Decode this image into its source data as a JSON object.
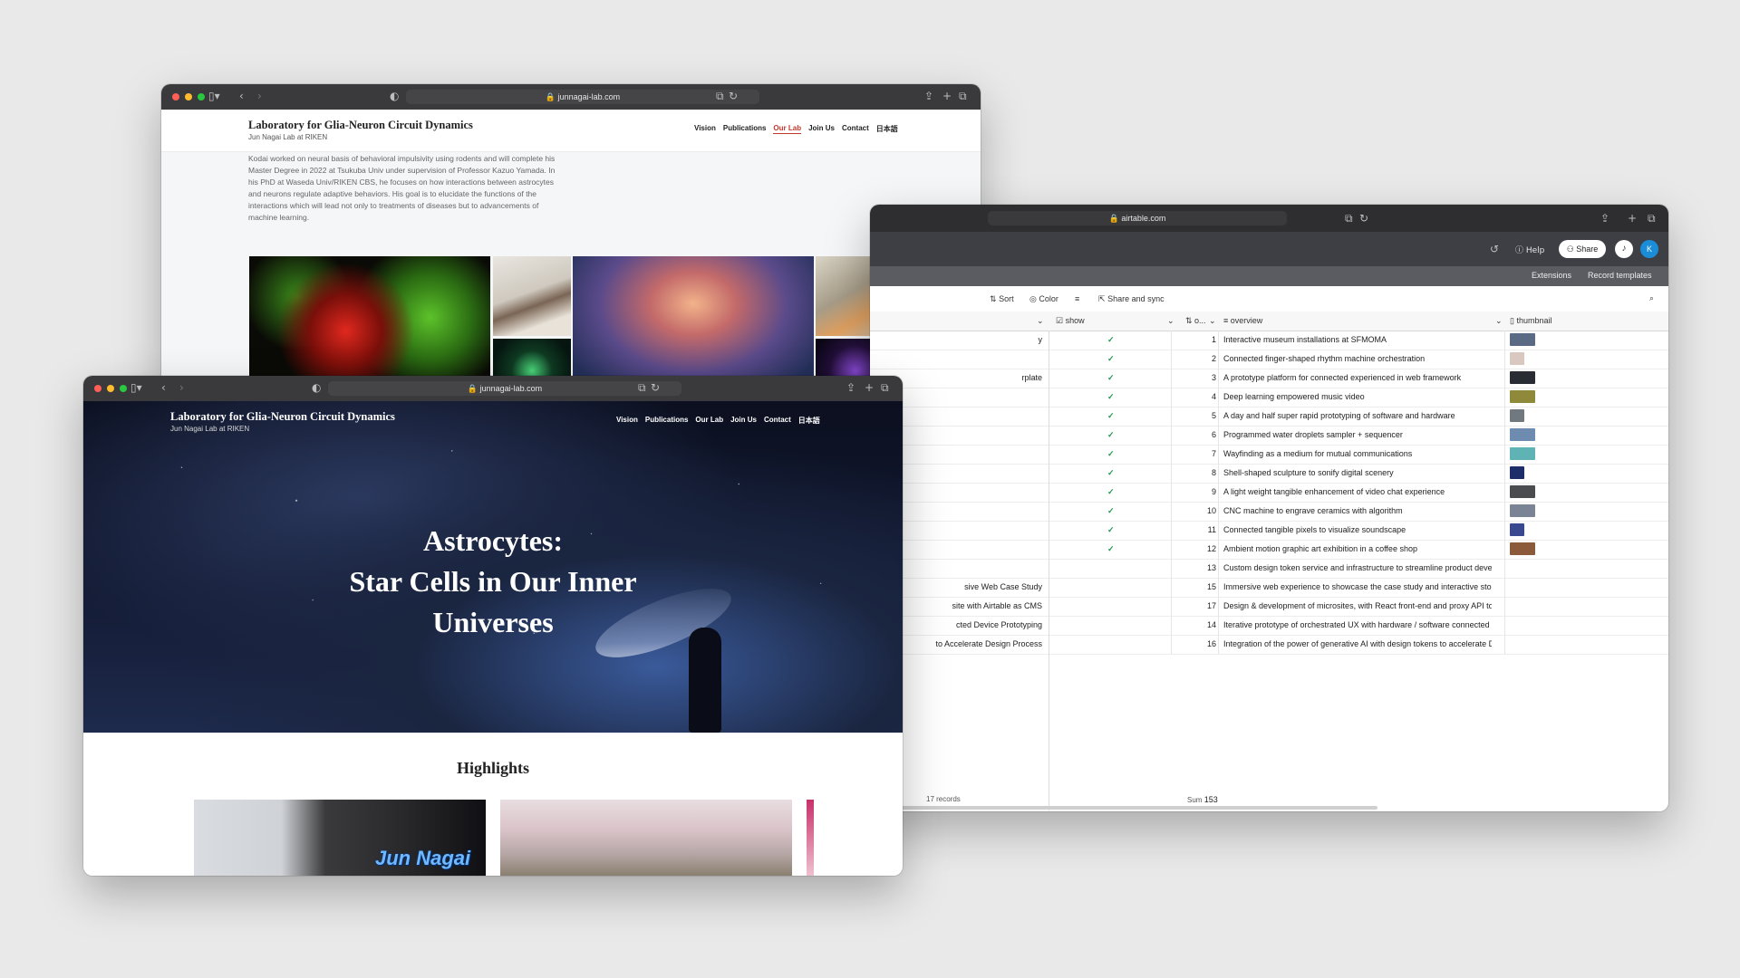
{
  "lab_site": {
    "url": "junnagai-lab.com",
    "title": "Laboratory for Glia-Neuron Circuit Dynamics",
    "subtitle": "Jun Nagai Lab at RIKEN",
    "nav": [
      "Vision",
      "Publications",
      "Our Lab",
      "Join Us",
      "Contact",
      "日本語"
    ],
    "active_nav": "Our Lab",
    "bio": "Kodai worked on neural basis of behavioral impulsivity using rodents and will complete his Master Degree in 2022 at Tsukuba Univ under supervision of Professor Kazuo Yamada. In his PhD at Waseda Univ/RIKEN CBS, he focuses on how interactions between astrocytes and neurons regulate adaptive behaviors. His goal is to elucidate the functions of the interactions which will lead not only to treatments of diseases but to advancements of machine learning.",
    "hero_title_1": "Astrocytes:",
    "hero_title_2": "Star Cells in Our Inner",
    "hero_title_3": "Universes",
    "highlights_heading": "Highlights",
    "highlight_caption": "Jun Nagai"
  },
  "airtable": {
    "url": "airtable.com",
    "help_label": "Help",
    "share_label": "Share",
    "avatar_initial": "K",
    "extensions_label": "Extensions",
    "record_templates_label": "Record templates",
    "toolbar": {
      "sort": "Sort",
      "color": "Color",
      "share_sync": "Share and sync"
    },
    "columns": {
      "show": "show",
      "order": "o...",
      "overview": "overview",
      "thumbnail": "thumbnail"
    },
    "rows": [
      {
        "name": "y",
        "show": true,
        "order": "1",
        "overview": "Interactive museum installations at SFMOMA",
        "thumb": "#5a6a84"
      },
      {
        "name": "",
        "show": true,
        "order": "2",
        "overview": "Connected finger-shaped rhythm machine orchestration",
        "thumb": "#d8c8c0"
      },
      {
        "name": "rplate",
        "show": true,
        "order": "3",
        "overview": "A prototype platform for connected experienced in web framework",
        "thumb": "#2a2c34"
      },
      {
        "name": "",
        "show": true,
        "order": "4",
        "overview": "Deep learning empowered music video",
        "thumb": "#8f8a3a"
      },
      {
        "name": "",
        "show": true,
        "order": "5",
        "overview": "A day and half super rapid prototyping of software and hardware",
        "thumb": "#707880"
      },
      {
        "name": "",
        "show": true,
        "order": "6",
        "overview": "Programmed water droplets sampler + sequencer",
        "thumb": "#6e8bb0"
      },
      {
        "name": "",
        "show": true,
        "order": "7",
        "overview": "Wayfinding as a medium for mutual communications",
        "thumb": "#5fb3b5"
      },
      {
        "name": "",
        "show": true,
        "order": "8",
        "overview": "Shell-shaped sculpture to sonify digital scenery",
        "thumb": "#1c2d6a"
      },
      {
        "name": "",
        "show": true,
        "order": "9",
        "overview": "A light weight tangible enhancement of video chat experience",
        "thumb": "#4a4c50"
      },
      {
        "name": "",
        "show": true,
        "order": "10",
        "overview": "CNC machine to engrave ceramics with algorithm",
        "thumb": "#7a8494"
      },
      {
        "name": "",
        "show": true,
        "order": "11",
        "overview": "Connected tangible pixels to visualize soundscape",
        "thumb": "#3a4890"
      },
      {
        "name": "",
        "show": true,
        "order": "12",
        "overview": "Ambient motion graphic art exhibition in a coffee shop",
        "thumb": "#8a5a3a"
      },
      {
        "name": "",
        "show": false,
        "order": "13",
        "overview": "Custom design token service and infrastructure to streamline product devel...",
        "thumb": ""
      },
      {
        "name": "sive Web Case Study",
        "show": false,
        "order": "15",
        "overview": "Immersive web experience to showcase the case study and interactive story...",
        "thumb": ""
      },
      {
        "name": "site with Airtable as CMS",
        "show": false,
        "order": "17",
        "overview": "Design & development of microsites, with React front-end and proxy API to l...",
        "thumb": ""
      },
      {
        "name": "cted Device Prototyping",
        "show": false,
        "order": "14",
        "overview": "Iterative prototype of orchestrated UX with hardware / software connected ...",
        "thumb": ""
      },
      {
        "name": "to Accelerate Design Process",
        "show": false,
        "order": "16",
        "overview": "Integration of the power of generative AI with design tokens to accelerate D...",
        "thumb": ""
      }
    ],
    "footer_records": "17 records",
    "footer_sum_label": "Sum",
    "footer_sum": "153"
  }
}
